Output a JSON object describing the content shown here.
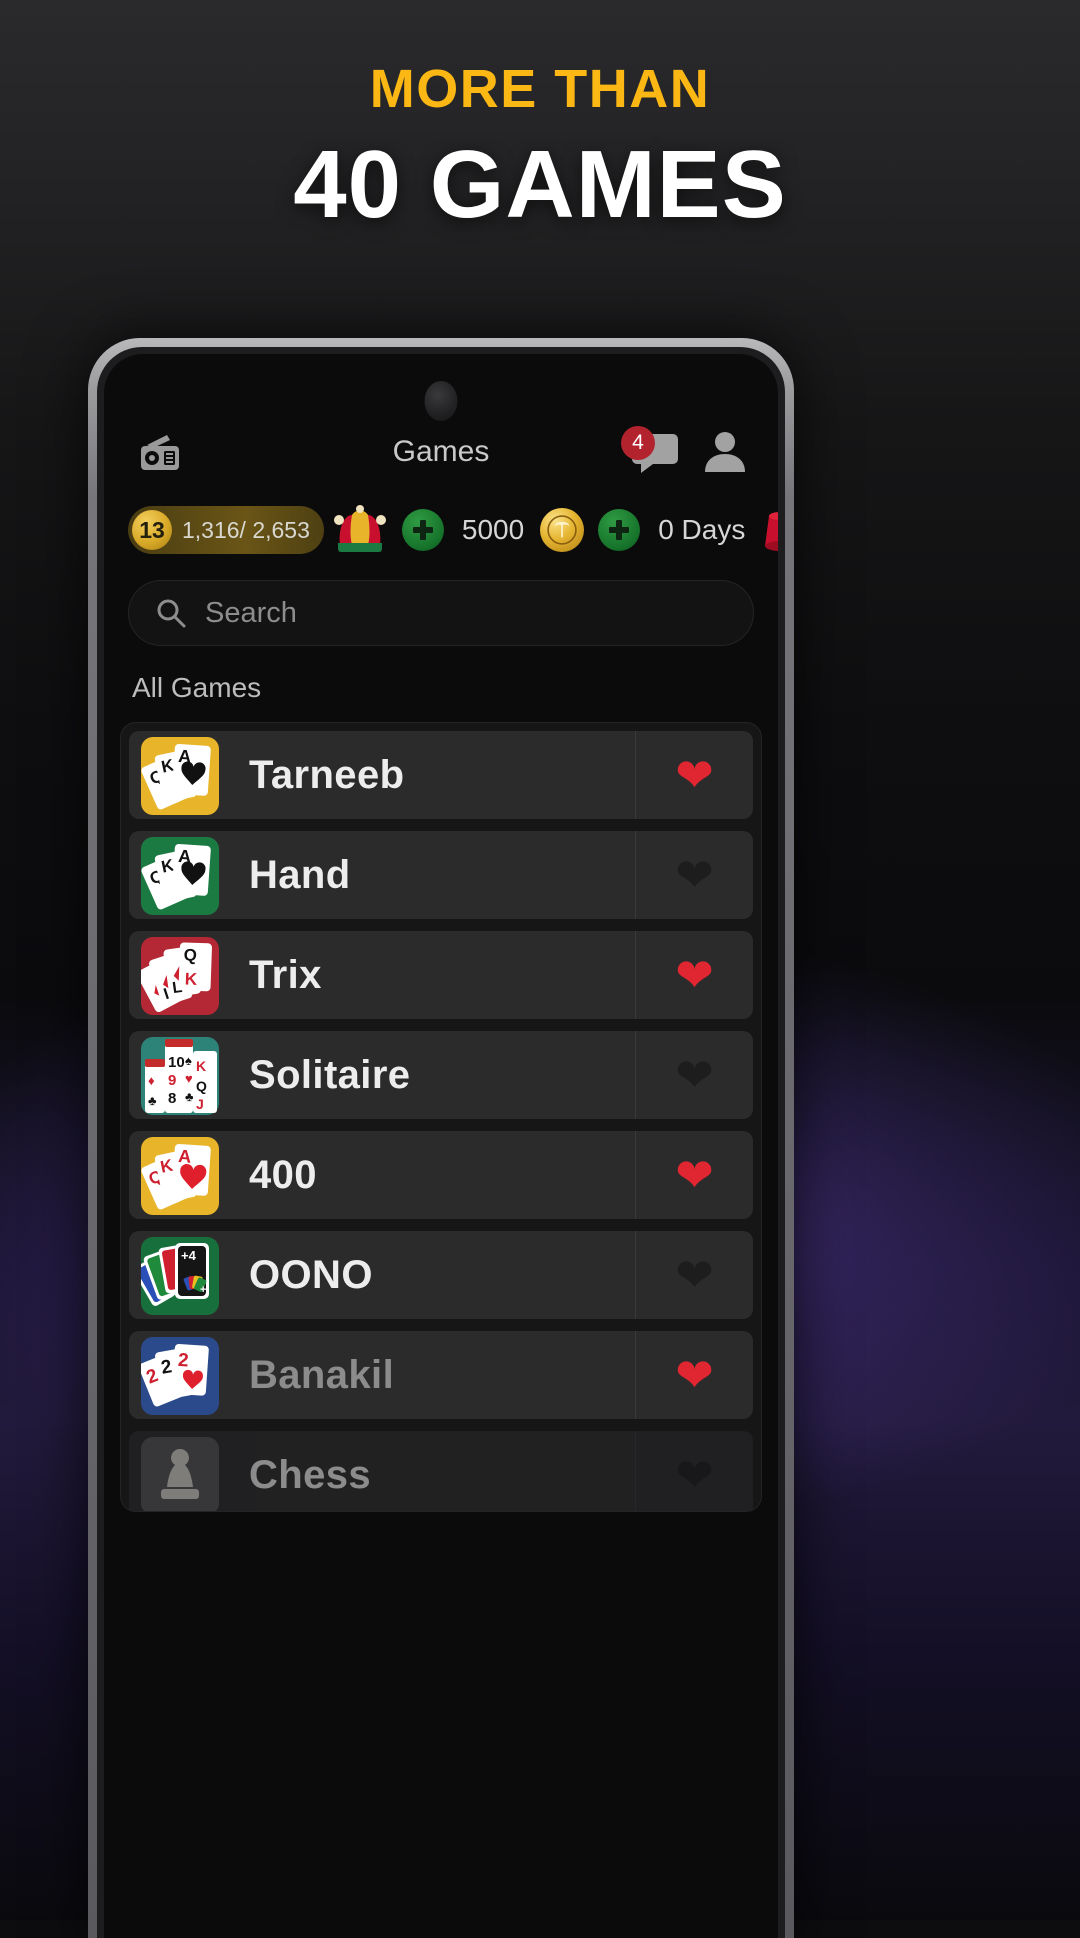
{
  "promo": {
    "kicker": "MORE THAN",
    "title": "40 GAMES",
    "kicker_color": "#FBB713",
    "title_color": "#FFFFFF"
  },
  "app": {
    "header": {
      "left_icon": "radio-icon",
      "title": "Games",
      "chat_icon": "chat-bubble-icon",
      "chat_badge": "4",
      "profile_icon": "profile-icon",
      "badge_color": "#B3232E"
    },
    "stats": {
      "level": "13",
      "xp": "1,316/ 2,653",
      "jester_icon": "jester-hat-icon",
      "add_joker_label": "+",
      "coins": "5000",
      "coin_icon": "gold-coin-icon",
      "add_coins_label": "+",
      "days": "0 Days",
      "fez_icon": "fez-hat-icon"
    },
    "search": {
      "placeholder": "Search",
      "icon": "search-icon",
      "value": ""
    },
    "section_title": "All Games",
    "favorite_on_color": "#E02631",
    "favorite_off_color": "#1D1D1E",
    "games": [
      {
        "name": "Tarneeb",
        "icon": "cards-spades-gold-icon",
        "favorite": true,
        "tile": "#E8B52A",
        "state": "normal"
      },
      {
        "name": "Hand",
        "icon": "cards-spades-green-icon",
        "favorite": false,
        "tile": "#1B7A42",
        "state": "normal"
      },
      {
        "name": "Trix",
        "icon": "cards-diamonds-red-icon",
        "favorite": true,
        "tile": "#B32834",
        "state": "normal"
      },
      {
        "name": "Solitaire",
        "icon": "solitaire-cards-icon",
        "favorite": false,
        "tile": "#2E8378",
        "state": "normal"
      },
      {
        "name": "400",
        "icon": "cards-hearts-gold-icon",
        "favorite": true,
        "tile": "#E8B52A",
        "state": "normal"
      },
      {
        "name": "OONO",
        "icon": "oono-cards-icon",
        "favorite": false,
        "tile": "#17703C",
        "state": "normal"
      },
      {
        "name": "Banakil",
        "icon": "cards-twos-blue-icon",
        "favorite": true,
        "tile": "#2B4A8C",
        "state": "dim"
      },
      {
        "name": "Chess",
        "icon": "chess-pawn-icon",
        "favorite": false,
        "tile": "#6B6B6B",
        "state": "fade"
      }
    ]
  }
}
